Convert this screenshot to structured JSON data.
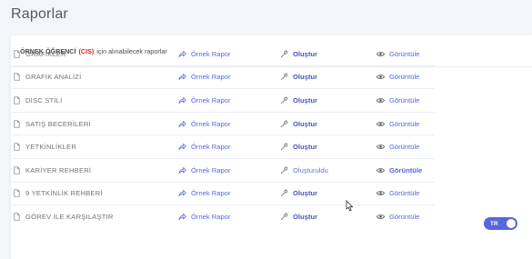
{
  "page": {
    "title": "Raporlar"
  },
  "header": {
    "student_prefix": "ÖRNEK ÖĞRENCİ",
    "student_code": "(CIS)",
    "suffix": "için alınabilecek raporlar"
  },
  "reports": [
    {
      "name": "GRAFİKLER",
      "sample": "Örnek Rapor",
      "create": "Oluştur",
      "view": "Görüntüle"
    },
    {
      "name": "GRAFİK ANALİZİ",
      "sample": "Örnek Rapor",
      "create": "Oluştur",
      "view": "Görüntüle"
    },
    {
      "name": "DISC STİLİ",
      "sample": "Örnek Rapor",
      "create": "Oluştur",
      "view": "Görüntüle"
    },
    {
      "name": "SATIŞ BECERİLERİ",
      "sample": "Örnek Rapor",
      "create": "Oluştur",
      "view": "Görüntüle"
    },
    {
      "name": "YETKİNLİKLER",
      "sample": "Örnek Rapor",
      "create": "Oluştur",
      "view": "Görüntüle"
    },
    {
      "name": "KARİYER REHBERİ",
      "sample": "Örnek Rapor",
      "create": "Oluşturuldu",
      "view": "Görüntüle"
    },
    {
      "name": "9 YETKİNLİK REHBERİ",
      "sample": "Örnek Rapor",
      "create": "Oluştur",
      "view": "Görüntüle"
    },
    {
      "name": "GÖREV İLE KARŞILAŞTIR",
      "sample": "Örnek Rapor",
      "create": "Oluştur",
      "view": "Görüntüle"
    }
  ],
  "language_toggle": {
    "label": "TR"
  },
  "icons": {
    "report": "document-icon",
    "sample": "share-arrow-icon",
    "create": "wrench-icon",
    "view": "eye-icon"
  },
  "colors": {
    "accent": "#5867dd",
    "highlight": "#e02020"
  }
}
